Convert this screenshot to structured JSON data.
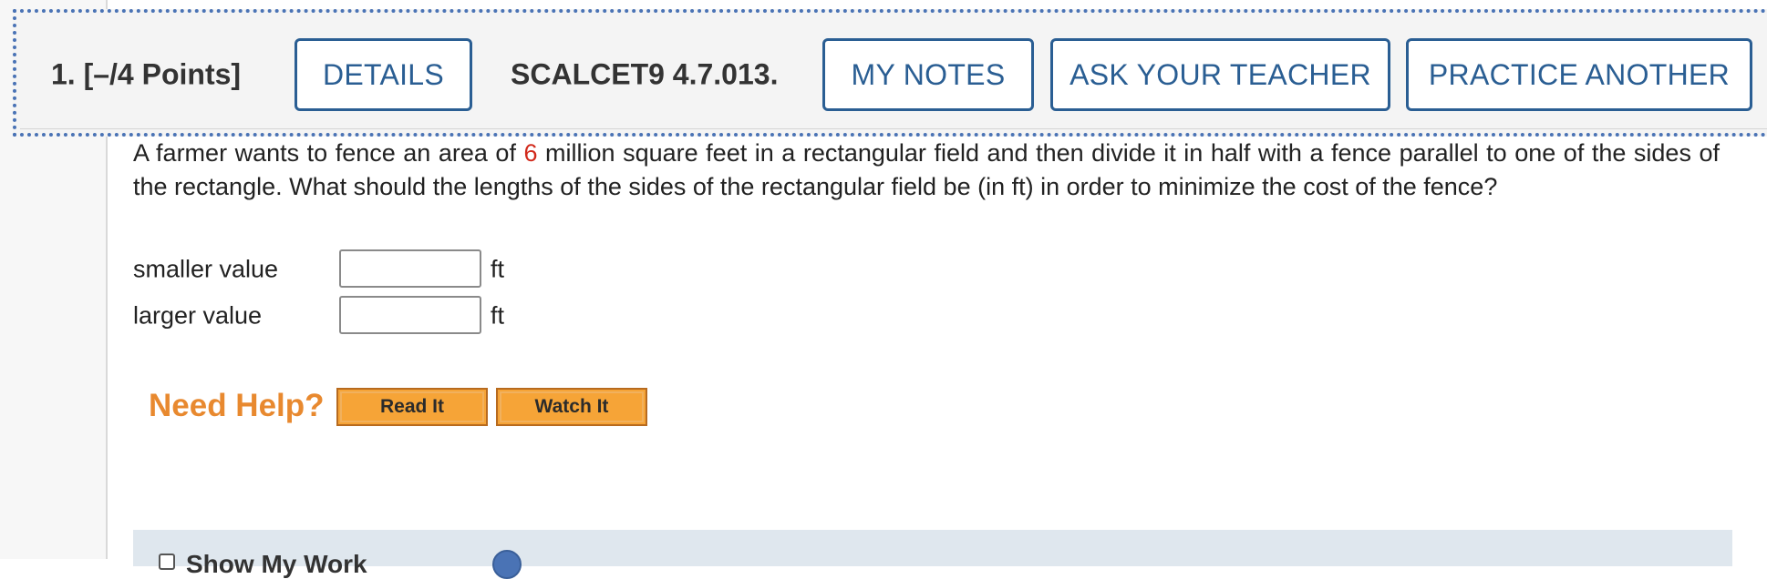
{
  "header": {
    "question_number": "1.",
    "points": "[–/4 Points]",
    "details_label": "DETAILS",
    "code": "SCALCET9 4.7.013.",
    "my_notes_label": "MY NOTES",
    "ask_teacher_label": "ASK YOUR TEACHER",
    "practice_another_label": "PRACTICE ANOTHER"
  },
  "question": {
    "text_before": "A farmer wants to fence an area of ",
    "highlighted_value": "6",
    "text_after": " million square feet in a rectangular field and then divide it in half with a fence parallel to one of the sides of the rectangle. What should the lengths of the sides of the rectangular field be (in ft) in order to minimize the cost of the fence?",
    "highlight_color": "#d1291b"
  },
  "answers": [
    {
      "label": "smaller value",
      "value": "",
      "unit": "ft"
    },
    {
      "label": "larger value",
      "value": "",
      "unit": "ft"
    }
  ],
  "help": {
    "title": "Need Help?",
    "read_label": "Read It",
    "watch_label": "Watch It"
  },
  "work": {
    "label": "Show My Work"
  },
  "colors": {
    "accent": "#2a5e93",
    "help_orange": "#e8892f",
    "button_orange": "#f6a437",
    "focus_dotted": "#4a73b5"
  }
}
